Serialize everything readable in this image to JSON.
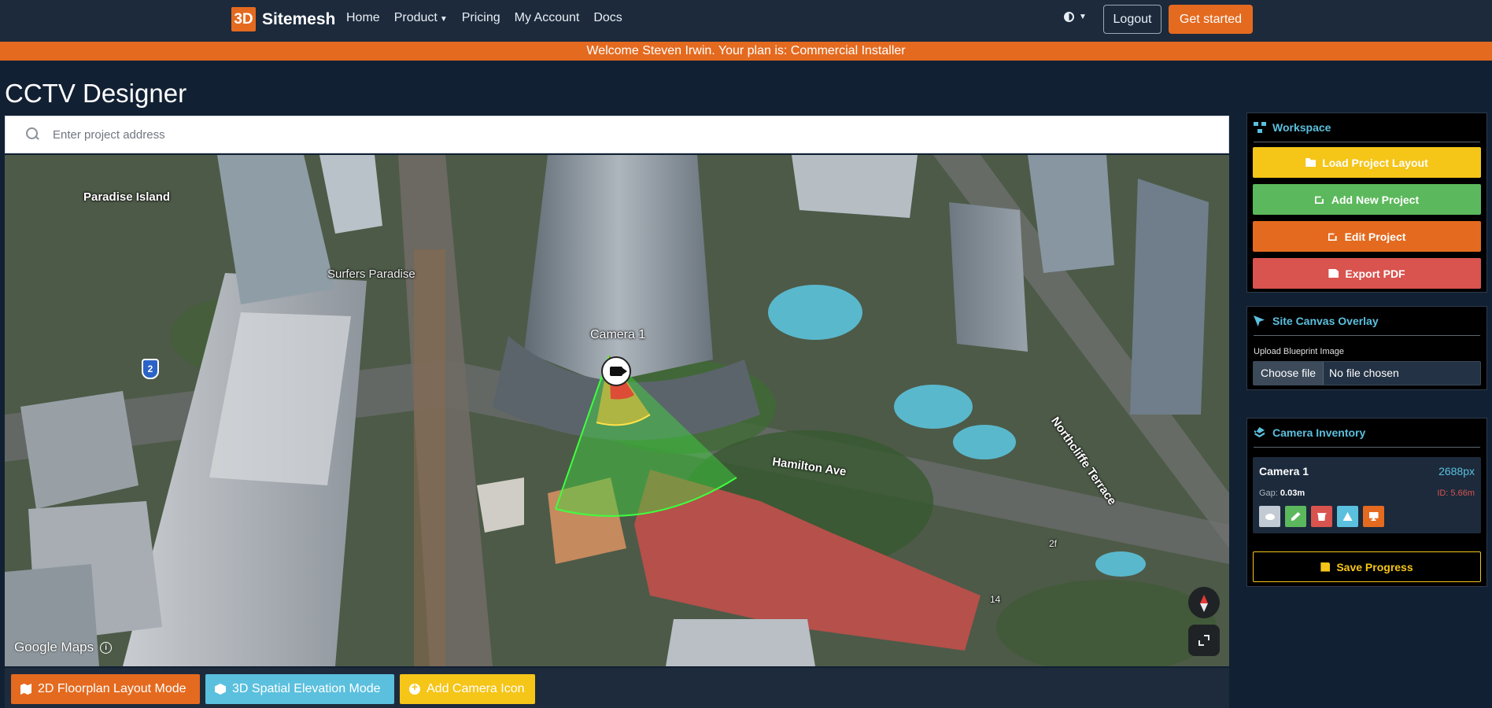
{
  "nav": {
    "brand_logo": "3D",
    "brand_name": "Sitemesh",
    "links": [
      "Home",
      "Product",
      "Pricing",
      "My Account",
      "Docs"
    ],
    "logout": "Logout",
    "get_started": "Get started",
    "accent_color": "#e46a1f"
  },
  "banner": {
    "text": "Welcome Steven Irwin. Your plan is: Commercial Installer"
  },
  "page": {
    "title": "CCTV Designer"
  },
  "search": {
    "placeholder": "Enter project address"
  },
  "map": {
    "labels": {
      "paradise_island": "Paradise Island",
      "surfers_paradise": "Surfers Paradise",
      "hamilton_ave": "Hamilton Ave",
      "northcliffe": "Northcliffe Terrace",
      "num_14": "14",
      "num_2f": "2f"
    },
    "route_shield": "2",
    "camera_label": "Camera 1",
    "attribution": "Google Maps",
    "info_glyph": "i"
  },
  "modes": {
    "floorplan": "2D Floorplan Layout Mode",
    "elevation": "3D Spatial Elevation Mode",
    "add_camera": "Add Camera Icon"
  },
  "workspace": {
    "header": "Workspace",
    "load": "Load Project Layout",
    "add_new": "Add New Project",
    "edit": "Edit Project",
    "export": "Export PDF"
  },
  "overlay": {
    "header": "Site Canvas Overlay",
    "upload_label": "Upload Blueprint Image",
    "choose_file": "Choose file",
    "no_file": "No file chosen"
  },
  "inventory": {
    "header": "Camera Inventory",
    "camera": {
      "name": "Camera 1",
      "pixels": "2688px",
      "gap_label": "Gap:",
      "gap_value": "0.03m",
      "id_label": "ID: 5.66m"
    },
    "save": "Save Progress"
  }
}
